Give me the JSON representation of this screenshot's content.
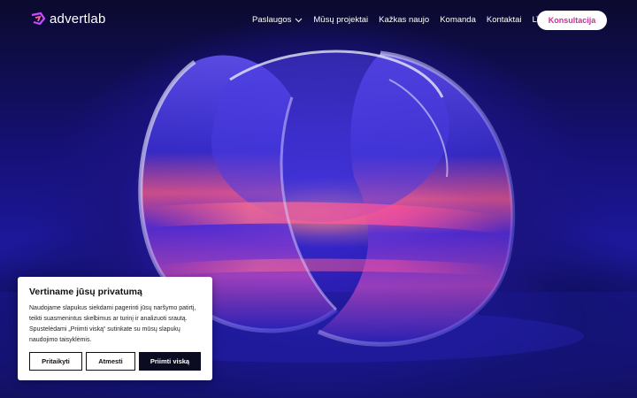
{
  "brand": {
    "name": "advertlab",
    "accent": "#d12a9a"
  },
  "nav": {
    "items": [
      {
        "label": "Paslaugos",
        "has_dropdown": true
      },
      {
        "label": "Mūsų projektai",
        "has_dropdown": false
      },
      {
        "label": "Kažkas naujo",
        "has_dropdown": false
      },
      {
        "label": "Komanda",
        "has_dropdown": false
      },
      {
        "label": "Kontaktai",
        "has_dropdown": false
      },
      {
        "label": "LT",
        "has_dropdown": true
      }
    ],
    "cta_label": "Konsultacija"
  },
  "cookie_banner": {
    "title": "Vertiname jūsų privatumą",
    "text": "Naudojame slapukus siekdami pagerinti jūsų naršymo patirtį, teikti suasmenintus skelbimus ar turinį ir analizuoti srautą. Spustelėdami „Priimti viską“ sutinkate su mūsų slapukų naudojimo taisyklėmis.",
    "buttons": {
      "customize": "Pritaikyti",
      "reject": "Atmesti",
      "accept_all": "Priimti viską"
    }
  },
  "icons": {
    "logo": "advertlab-logo-icon",
    "dropdown": "chevron-down-icon"
  }
}
